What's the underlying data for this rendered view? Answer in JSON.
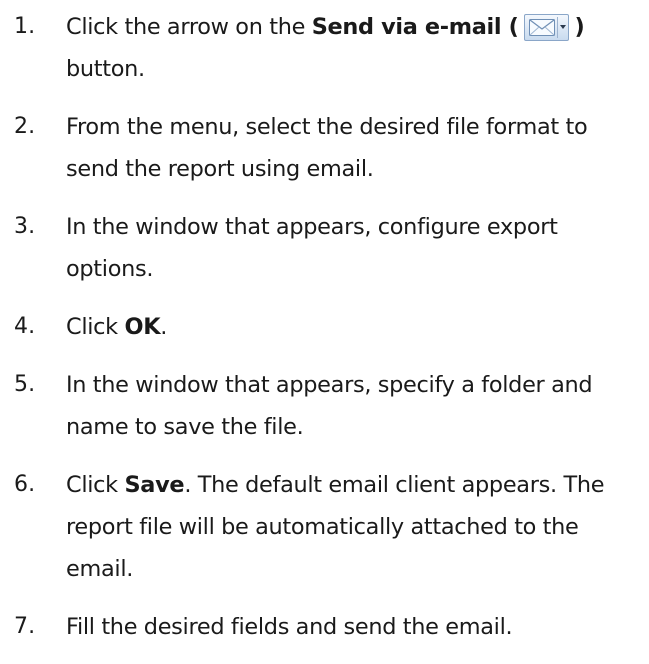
{
  "steps": [
    {
      "number": "1.",
      "before": "Click the arrow on the ",
      "bold": "Send via e-mail (",
      "icon": "email-icon",
      "bold_after": ")",
      "after": " button."
    },
    {
      "number": "2.",
      "text": "From the menu, select the desired file format to send the report using email."
    },
    {
      "number": "3.",
      "text": "In the window that appears, configure export options."
    },
    {
      "number": "4.",
      "before": "Click ",
      "bold": "OK",
      "after": "."
    },
    {
      "number": "5.",
      "text": "In the window that appears, specify a folder and name to save the file."
    },
    {
      "number": "6.",
      "before": "Click ",
      "bold": "Save",
      "after": ". The default email client appears. The report file will be automatically attached to the email."
    },
    {
      "number": "7.",
      "text": "Fill the desired fields and send the email."
    }
  ]
}
